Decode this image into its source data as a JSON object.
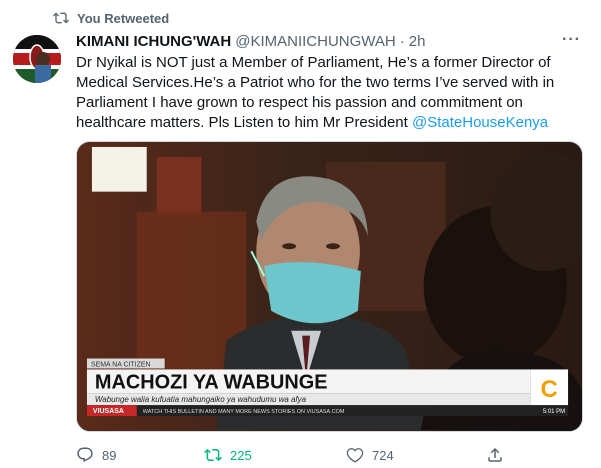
{
  "retweet_banner": {
    "label": "You Retweeted"
  },
  "author": {
    "name": "KIMANI ICHUNG'WAH",
    "handle": "@KIMANIICHUNGWAH",
    "separator": "·",
    "time": "2h"
  },
  "tweet": {
    "text": "Dr Nyikal is NOT just a Member of Parliament, He’s a former Director of Medical Services.He’s a Patriot who for the two terms I’ve served with in Parliament I have grown to respect his passion and commitment on healthcare matters. Pls Listen to him Mr President ",
    "mention": "@StateHouseKenya"
  },
  "video": {
    "banner_tag": "SEMA NA CITIZEN",
    "headline": "MACHOZI YA WABUNGE",
    "subheadline": "Wabunge walia kufuatia mahungaiko ya wahudumu wa afya",
    "ticker_label": "VIUSASA",
    "ticker_text": "WATCH THIS BULLETIN AND MANY MORE NEWS STORIES ON VIUSASA.COM",
    "channel_logo": "C",
    "clock": "5:01 PM"
  },
  "actions": {
    "replies": "89",
    "retweets": "225",
    "likes": "724"
  },
  "colors": {
    "accent": "#1d9bf0",
    "retweet_active": "#00ba7c",
    "muted": "#536471"
  }
}
